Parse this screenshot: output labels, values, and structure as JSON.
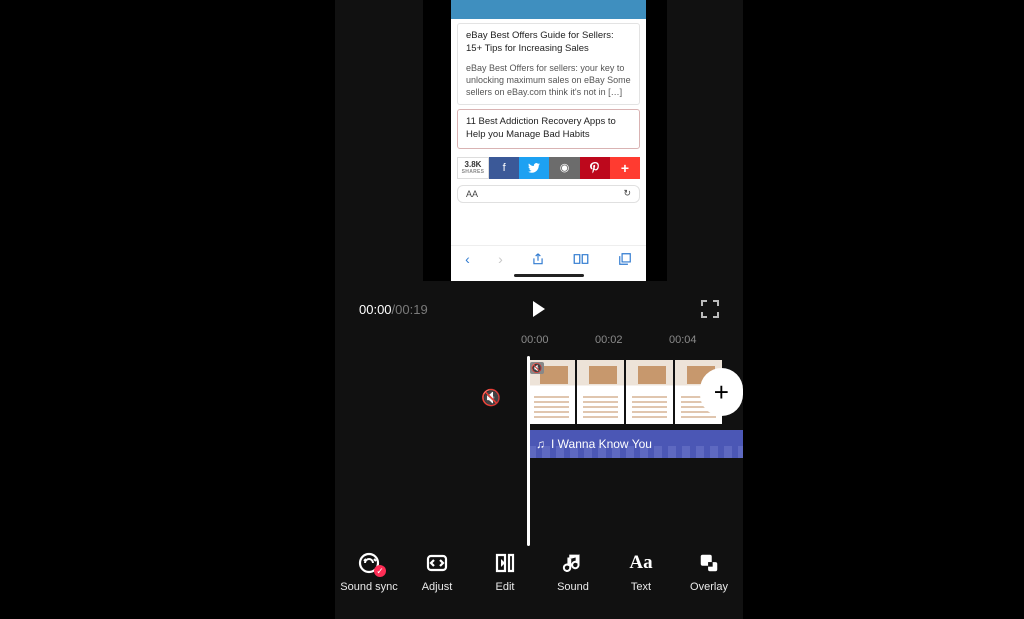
{
  "preview": {
    "card1_title": "eBay Best Offers Guide for Sellers: 15+ Tips for Increasing Sales",
    "card1_desc": "eBay Best Offers for sellers: your key to unlocking maximum sales on eBay Some sellers on eBay.com think it's not in […]",
    "card2_title": "11 Best Addiction Recovery Apps to Help you Manage Bad Habits",
    "share_count": "3.8K",
    "share_label": "SHARES",
    "url_left": "AA",
    "url_right": "↻",
    "safari": {
      "back": "‹",
      "fwd": "›",
      "share": "⇧",
      "book": "▢▢",
      "tabs": "❐"
    }
  },
  "playback": {
    "current": "00:00",
    "sep": "/",
    "total": "00:19"
  },
  "ruler": [
    "00:00",
    "00:02",
    "00:04"
  ],
  "mute_glyph": "🔇",
  "audio": {
    "note": "♫",
    "title": "I Wanna Know You"
  },
  "add_glyph": "+",
  "tools": {
    "sound_sync": "Sound sync",
    "adjust": "Adjust",
    "edit": "Edit",
    "sound": "Sound",
    "text": "Text",
    "overlay": "Overlay",
    "badge": "✓"
  },
  "thumb_mute": "🔇"
}
